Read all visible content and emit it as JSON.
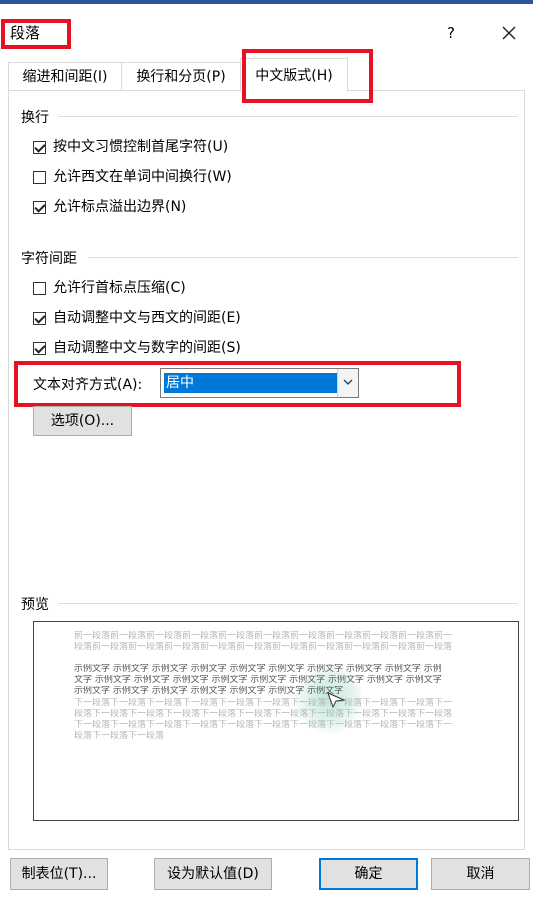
{
  "dialog": {
    "title": "段落",
    "help": "?",
    "close_icon": "close-icon"
  },
  "tabs": [
    {
      "label": "缩进和间距(I)",
      "active": false
    },
    {
      "label": "换行和分页(P)",
      "active": false
    },
    {
      "label": "中文版式(H)",
      "active": true
    }
  ],
  "line_break": {
    "title": "换行",
    "options": [
      {
        "label": "按中文习惯控制首尾字符(U)",
        "checked": true
      },
      {
        "label": "允许西文在单词中间换行(W)",
        "checked": false
      },
      {
        "label": "允许标点溢出边界(N)",
        "checked": true
      }
    ]
  },
  "char_spacing": {
    "title": "字符间距",
    "options": [
      {
        "label": "允许行首标点压缩(C)",
        "checked": false
      },
      {
        "label": "自动调整中文与西文的间距(E)",
        "checked": true
      },
      {
        "label": "自动调整中文与数字的间距(S)",
        "checked": true
      }
    ]
  },
  "text_align": {
    "label": "文本对齐方式(A):",
    "value": "居中"
  },
  "options_button": "选项(O)...",
  "preview": {
    "title": "预览",
    "prev_lines": [
      "前一段落前一段落前一段落前一段落前一段落前一段落前一段落前一段落前一段落前一段落前一",
      "段落前一段落前一段落前一段落前一段落前一段落前一段落前一段落前一段落前一段落前一段落"
    ],
    "sample_lines": [
      "示例文字 示例文字 示例文字 示例文字 示例文字 示例文字 示例文字 示例文字 示例文字 示例",
      "文字 示例文字 示例文字 示例文字 示例文字 示例文字 示例文字 示例文字 示例文字 示例文字",
      "示例文字 示例文字 示例文字 示例文字 示例文字 示例文字 示例文字"
    ],
    "next_lines": [
      "下一段落下一段落下一段落下一段落下一段落下一段落下一段落下一段落下一段落下一段落下一",
      "段落下一段落下一段落下一段落下一段落下一段落下一段落下一段落下一段落下一段落下一段落",
      "下一段落下一段落下一段落下一段落下一段落下一段落下一段落下一段落下一段落下一段落下一",
      "段落下一段落下一段落"
    ]
  },
  "footer": {
    "tabs_button": "制表位(T)...",
    "default_button": "设为默认值(D)",
    "ok_button": "确定",
    "cancel_button": "取消"
  },
  "colors": {
    "highlight": "#e81123",
    "accent": "#0078d7"
  }
}
